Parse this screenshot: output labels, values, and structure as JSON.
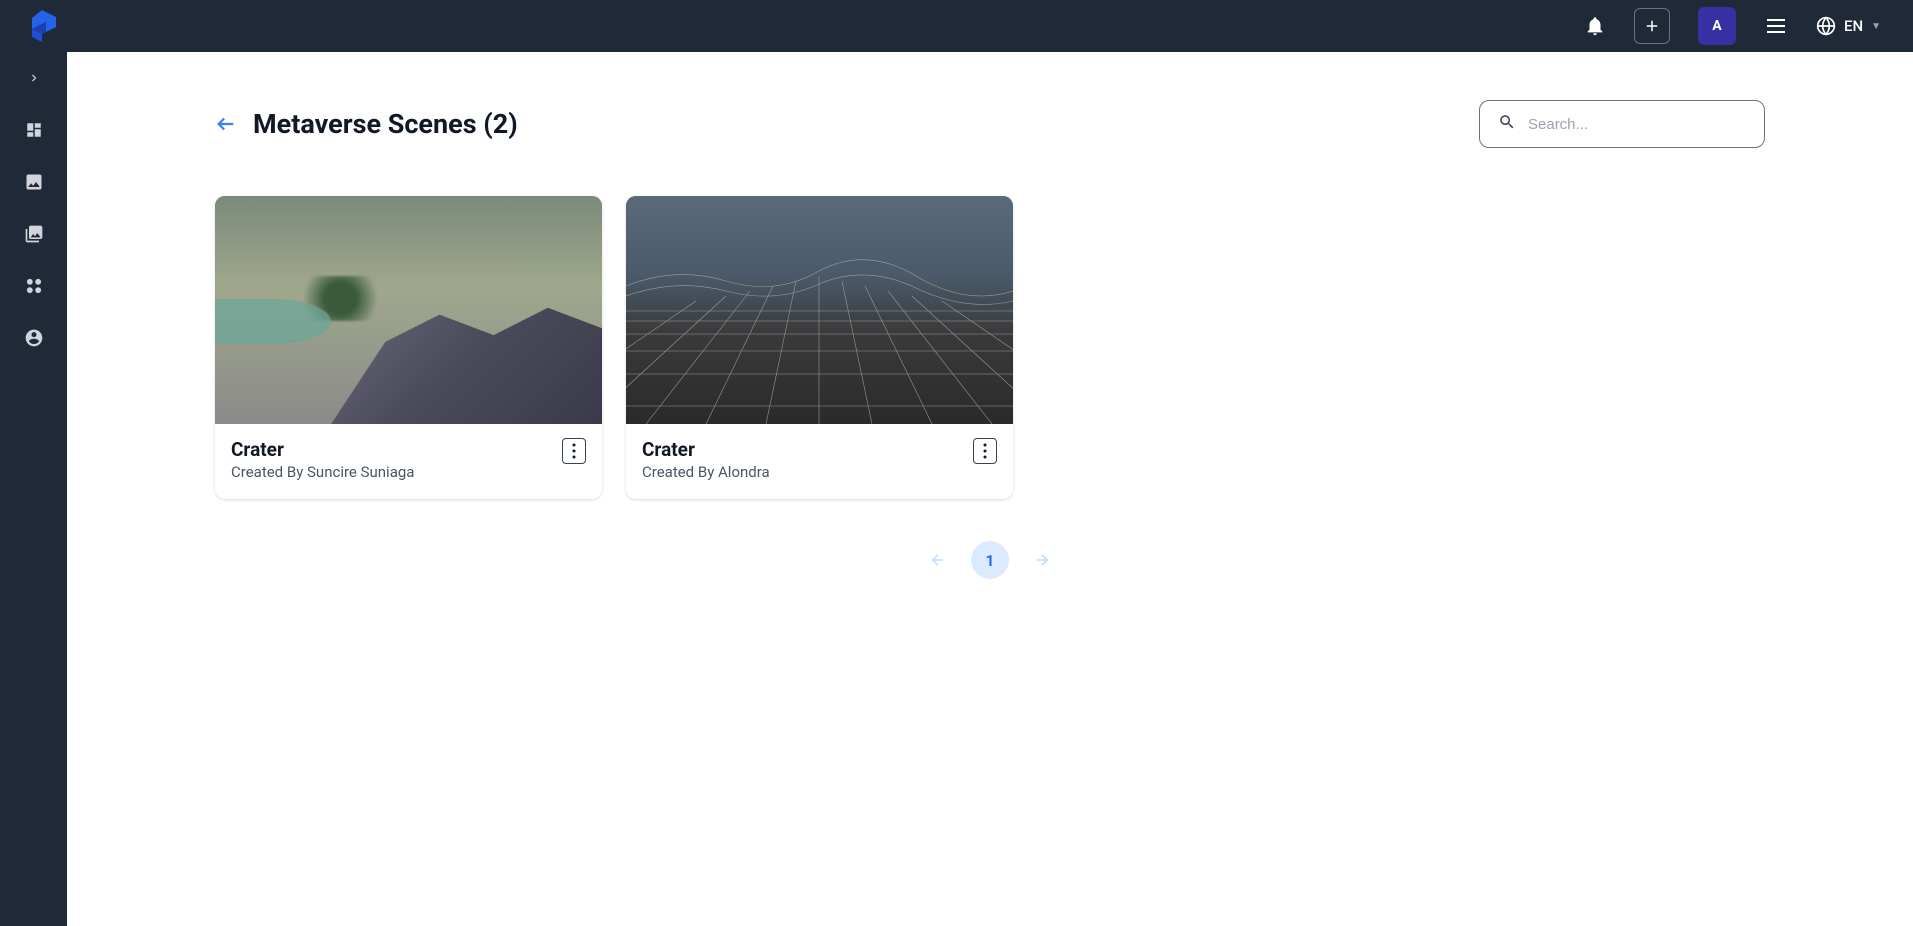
{
  "header": {
    "avatar_letter": "A",
    "lang": "EN"
  },
  "page": {
    "title": "Metaverse Scenes (2)",
    "search_placeholder": "Search..."
  },
  "scenes": [
    {
      "title": "Crater",
      "subtitle": "Created By Suncire Suniaga"
    },
    {
      "title": "Crater",
      "subtitle": "Created By Alondra"
    }
  ],
  "pagination": {
    "current": "1"
  }
}
